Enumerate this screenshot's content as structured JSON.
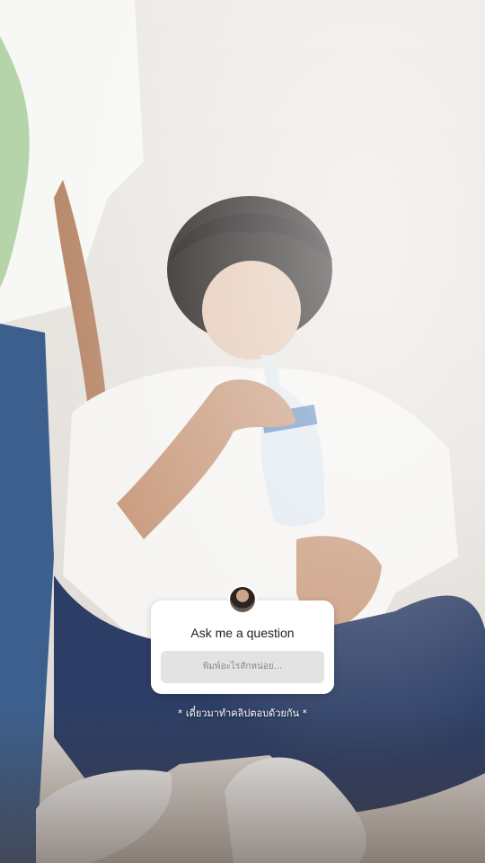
{
  "question_sticker": {
    "prompt": "Ask me a question",
    "input_placeholder": "พิมพ์อะไรสักหน่อย..."
  },
  "caption": "* เดี๋ยวมาทำคลิปตอบด้วยกัน *",
  "colors": {
    "sticker_bg": "#ffffff",
    "input_bg": "#e3e3e3",
    "caption_text": "#ffffff"
  },
  "icons": {
    "profile_avatar": "avatar-icon"
  }
}
